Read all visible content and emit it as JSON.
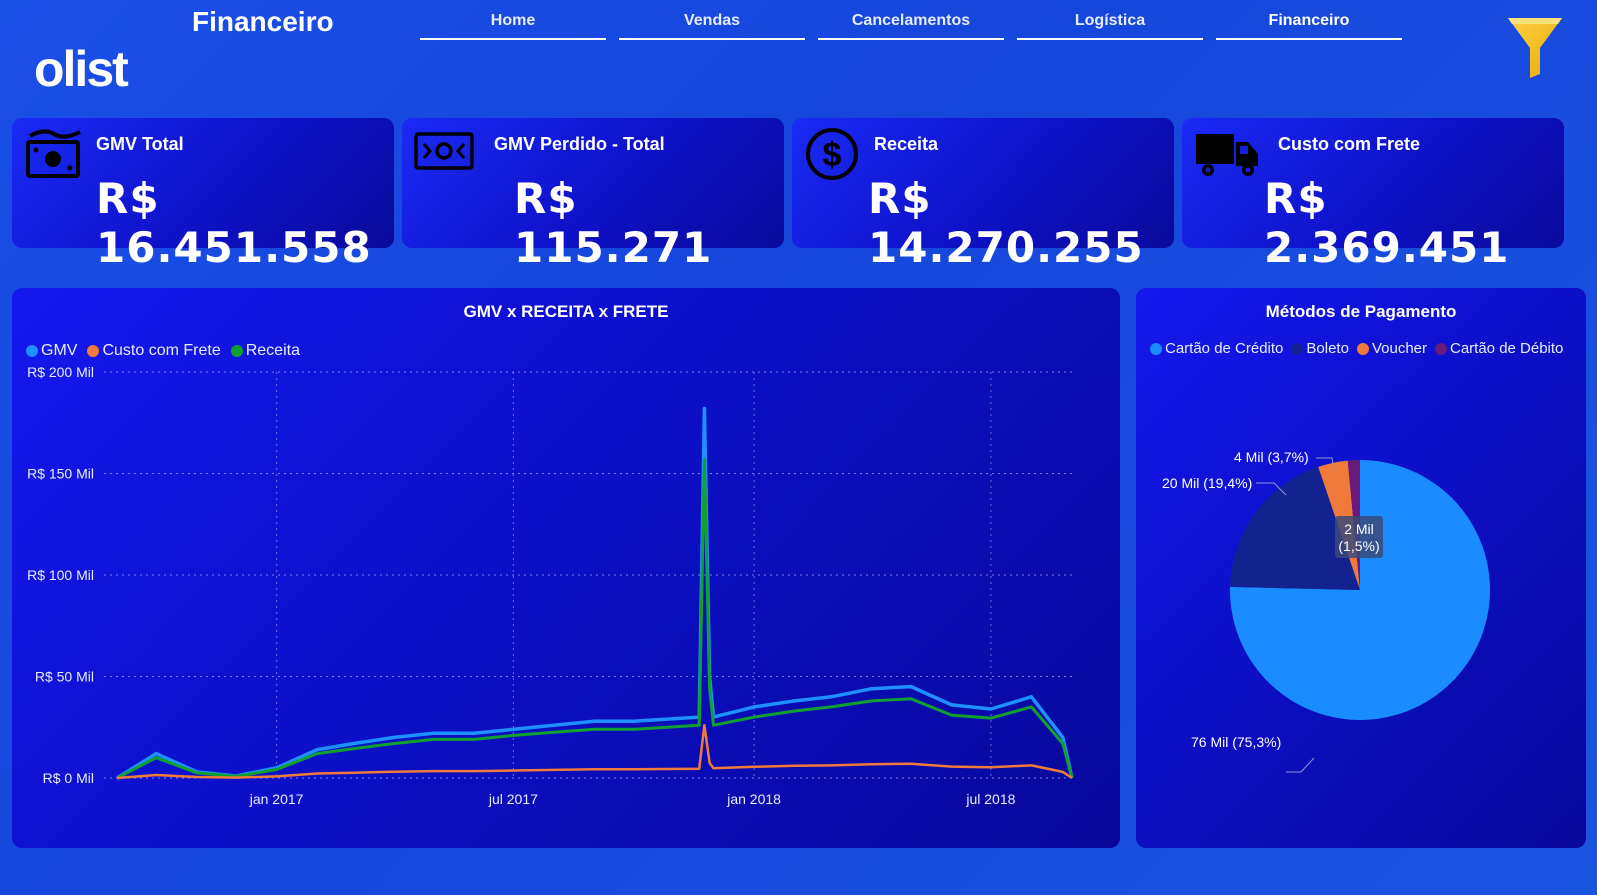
{
  "header": {
    "title": "Financeiro",
    "logo_text": "olist",
    "nav": [
      {
        "label": "Home"
      },
      {
        "label": "Vendas"
      },
      {
        "label": "Cancelamentos"
      },
      {
        "label": "Logística"
      },
      {
        "label": "Financeiro",
        "active": true
      }
    ]
  },
  "kpis": [
    {
      "label": "GMV Total",
      "value": "R$ 16.451.558",
      "icon": "money-bill-icon"
    },
    {
      "label": "GMV Perdido - Total",
      "value": "R$ 115.271",
      "icon": "money-transfer-icon"
    },
    {
      "label": "Receita",
      "value": "R$ 14.270.255",
      "icon": "dollar-circle-icon"
    },
    {
      "label": "Custo com Frete",
      "value": "R$ 2.369.451",
      "icon": "truck-icon"
    }
  ],
  "line_panel": {
    "title": "GMV  x  RECEITA  x  FRETE",
    "legend": [
      {
        "name": "GMV",
        "color": "#1e90ff"
      },
      {
        "name": "Custo com Frete",
        "color": "#f07a3a"
      },
      {
        "name": "Receita",
        "color": "#10a030"
      }
    ],
    "y_ticks": [
      "R$ 200 Mil",
      "R$ 150 Mil",
      "R$ 100 Mil",
      "R$ 50 Mil",
      "R$ 0 Mil"
    ],
    "x_ticks": [
      "jan 2017",
      "jul 2017",
      "jan 2018",
      "jul 2018"
    ]
  },
  "pie_panel": {
    "title": "Métodos de Pagamento",
    "legend": [
      {
        "name": "Cartão de Crédito",
        "color": "#1a8cff"
      },
      {
        "name": "Boleto",
        "color": "#12238f"
      },
      {
        "name": "Voucher",
        "color": "#f07a3a"
      },
      {
        "name": "Cartão de Débito",
        "color": "#6a1a7a"
      }
    ],
    "labels": {
      "credit": "76 Mil (75,3%)",
      "boleto": "20 Mil (19,4%)",
      "voucher": "4 Mil (3,7%)",
      "debit_line1": "2 Mil",
      "debit_line2": "(1,5%)"
    }
  },
  "chart_data": [
    {
      "type": "line",
      "title": "GMV  x  RECEITA  x  FRETE",
      "xlabel": "",
      "ylabel": "",
      "ylim": [
        0,
        200000
      ],
      "x": [
        "2016-09",
        "2016-10",
        "2016-11",
        "2016-12",
        "2017-01",
        "2017-02",
        "2017-03",
        "2017-04",
        "2017-05",
        "2017-06",
        "2017-07",
        "2017-08",
        "2017-09",
        "2017-10",
        "2017-11-20",
        "2017-11-24",
        "2017-11-28",
        "2017-12",
        "2018-01",
        "2018-02",
        "2018-03",
        "2018-04",
        "2018-05",
        "2018-06",
        "2018-07",
        "2018-08",
        "2018-08-25",
        "2018-09"
      ],
      "series": [
        {
          "name": "GMV",
          "values": [
            0,
            12000,
            3000,
            1000,
            5000,
            14000,
            17000,
            20000,
            22000,
            22000,
            24000,
            26000,
            28000,
            28000,
            30000,
            182000,
            50000,
            30000,
            35000,
            38000,
            40000,
            44000,
            45000,
            36000,
            34000,
            40000,
            20000,
            0
          ]
        },
        {
          "name": "Custo com Frete",
          "values": [
            0,
            1500,
            500,
            200,
            800,
            2200,
            2600,
            3100,
            3400,
            3400,
            3700,
            4000,
            4300,
            4300,
            4600,
            26000,
            7500,
            4800,
            5500,
            6000,
            6200,
            6800,
            7000,
            5600,
            5300,
            6200,
            3000,
            0
          ]
        },
        {
          "name": "Receita",
          "values": [
            0,
            10000,
            2500,
            800,
            4200,
            12000,
            14500,
            17000,
            19000,
            19000,
            21000,
            22500,
            24000,
            24000,
            26000,
            157000,
            44000,
            26000,
            30000,
            33000,
            35000,
            38000,
            39000,
            31000,
            29500,
            35000,
            17000,
            0
          ]
        }
      ],
      "legend": "top-left",
      "grid": true
    },
    {
      "type": "pie",
      "title": "Métodos de Pagamento",
      "categories": [
        "Cartão de Crédito",
        "Boleto",
        "Voucher",
        "Cartão de Débito"
      ],
      "values": [
        75.3,
        19.4,
        3.7,
        1.5
      ],
      "counts": [
        "76 Mil",
        "20 Mil",
        "4 Mil",
        "2 Mil"
      ],
      "legend": "top"
    }
  ]
}
